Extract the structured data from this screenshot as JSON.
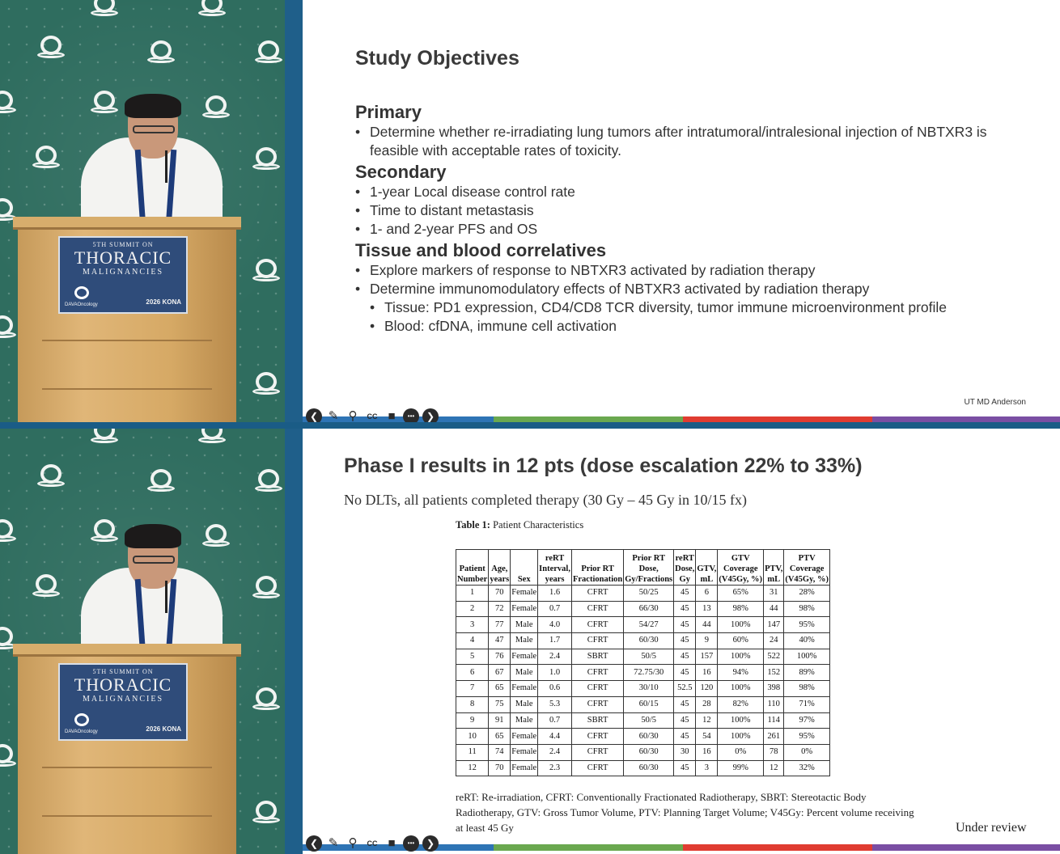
{
  "podium_sign": {
    "line1": "5TH SUMMIT ON",
    "line2": "THORACIC",
    "line3": "MALIGNANCIES",
    "brand": "DAVAOncology",
    "year_badge": "2026 KONA"
  },
  "controls": {
    "prev": "❮",
    "pen": "✎",
    "zoom": "⚲",
    "cc": "CC",
    "video": "■",
    "more": "•••",
    "next": "❯"
  },
  "slide1": {
    "title": "Study Objectives",
    "primary_heading": "Primary",
    "primary_bullets": [
      "Determine whether re-irradiating lung tumors after intratumoral/intralesional injection of NBTXR3 is feasible with acceptable rates of toxicity."
    ],
    "secondary_heading": "Secondary",
    "secondary_bullets": [
      "1-year Local disease control rate",
      "Time to distant metastasis",
      "1- and 2-year PFS and OS"
    ],
    "tissue_heading": "Tissue and blood correlatives",
    "tissue_bullets": [
      "Explore markers of response to NBTXR3 activated by radiation therapy",
      "Determine immunomodulatory effects of NBTXR3 activated by radiation therapy"
    ],
    "tissue_subbullets": [
      "Tissue: PD1 expression, CD4/CD8 TCR diversity, tumor immune microenvironment profile",
      "Blood: cfDNA, immune cell activation"
    ],
    "footer": "UT MD Anderson"
  },
  "slide2": {
    "title": "Phase I results in 12 pts (dose escalation 22% to 33%)",
    "subtitle": "No DLTs, all patients completed therapy (30 Gy – 45 Gy in 10/15 fx)",
    "table_caption_bold": "Table 1:",
    "table_caption": " Patient Characteristics",
    "columns": [
      [
        "Patient",
        "Number"
      ],
      [
        "Age,",
        "years"
      ],
      [
        "",
        "Sex"
      ],
      [
        "reRT",
        "Interval,",
        "years"
      ],
      [
        "Prior RT",
        "Fractionation"
      ],
      [
        "Prior RT",
        "Dose,",
        "Gy/Fractions"
      ],
      [
        "reRT",
        "Dose,",
        "Gy"
      ],
      [
        "GTV,",
        "mL"
      ],
      [
        "GTV",
        "Coverage",
        "(V45Gy, %)"
      ],
      [
        "PTV,",
        "mL"
      ],
      [
        "PTV",
        "Coverage",
        "(V45Gy, %)"
      ]
    ],
    "rows": [
      [
        "1",
        "70",
        "Female",
        "1.6",
        "CFRT",
        "50/25",
        "45",
        "6",
        "65%",
        "31",
        "28%"
      ],
      [
        "2",
        "72",
        "Female",
        "0.7",
        "CFRT",
        "66/30",
        "45",
        "13",
        "98%",
        "44",
        "98%"
      ],
      [
        "3",
        "77",
        "Male",
        "4.0",
        "CFRT",
        "54/27",
        "45",
        "44",
        "100%",
        "147",
        "95%"
      ],
      [
        "4",
        "47",
        "Male",
        "1.7",
        "CFRT",
        "60/30",
        "45",
        "9",
        "60%",
        "24",
        "40%"
      ],
      [
        "5",
        "76",
        "Female",
        "2.4",
        "SBRT",
        "50/5",
        "45",
        "157",
        "100%",
        "522",
        "100%"
      ],
      [
        "6",
        "67",
        "Male",
        "1.0",
        "CFRT",
        "72.75/30",
        "45",
        "16",
        "94%",
        "152",
        "89%"
      ],
      [
        "7",
        "65",
        "Female",
        "0.6",
        "CFRT",
        "30/10",
        "52.5",
        "120",
        "100%",
        "398",
        "98%"
      ],
      [
        "8",
        "75",
        "Male",
        "5.3",
        "CFRT",
        "60/15",
        "45",
        "28",
        "82%",
        "110",
        "71%"
      ],
      [
        "9",
        "91",
        "Male",
        "0.7",
        "SBRT",
        "50/5",
        "45",
        "12",
        "100%",
        "114",
        "97%"
      ],
      [
        "10",
        "65",
        "Female",
        "4.4",
        "CFRT",
        "60/30",
        "45",
        "54",
        "100%",
        "261",
        "95%"
      ],
      [
        "11",
        "74",
        "Female",
        "2.4",
        "CFRT",
        "60/30",
        "30",
        "16",
        "0%",
        "78",
        "0%"
      ],
      [
        "12",
        "70",
        "Female",
        "2.3",
        "CFRT",
        "60/30",
        "45",
        "3",
        "99%",
        "12",
        "32%"
      ]
    ],
    "legend": "reRT: Re-irradiation, CFRT: Conventionally Fractionated Radiotherapy, SBRT: Stereotactic Body Radiotherapy, GTV: Gross Tumor Volume, PTV: Planning Target Volume; V45Gy: Percent volume receiving at least 45 Gy",
    "under_review": "Under review"
  },
  "colors": {
    "bar": [
      "#2e74b5",
      "#6aa84f",
      "#e03c31",
      "#7a4ea3"
    ],
    "backdrop": "#2f6d5f",
    "frame": "#1f5f8a"
  }
}
